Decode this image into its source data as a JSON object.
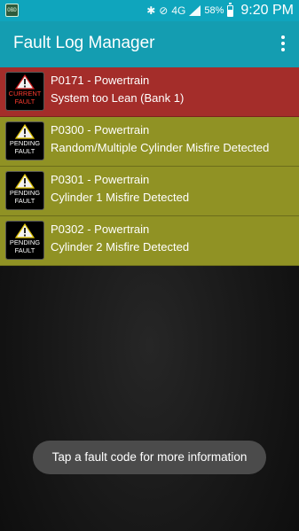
{
  "status_bar": {
    "network": "4G",
    "battery_percent": "58%",
    "battery_level": 0.58,
    "time": "9:20 PM",
    "icons": [
      "app-notification-icon",
      "bluetooth-icon",
      "vibrate-icon",
      "lte-icon",
      "signal-icon",
      "battery-icon"
    ]
  },
  "app_bar": {
    "title": "Fault Log Manager",
    "menu_icon": "overflow-menu-icon"
  },
  "faults": [
    {
      "code": "P0171 - Powertrain",
      "description": "System too Lean (Bank 1)",
      "status": [
        "CURRENT",
        "FAULT"
      ],
      "kind": "current",
      "color": "#a42d2a"
    },
    {
      "code": "P0300 - Powertrain",
      "description": "Random/Multiple Cylinder Misfire Detected",
      "status": [
        "PENDING",
        "FAULT"
      ],
      "kind": "pending",
      "color": "#909224"
    },
    {
      "code": "P0301 - Powertrain",
      "description": "Cylinder 1 Misfire Detected",
      "status": [
        "PENDING",
        "FAULT"
      ],
      "kind": "pending",
      "color": "#909224"
    },
    {
      "code": "P0302 - Powertrain",
      "description": "Cylinder 2 Misfire Detected",
      "status": [
        "PENDING",
        "FAULT"
      ],
      "kind": "pending",
      "color": "#909224"
    }
  ],
  "toast": {
    "message": "Tap a fault code for more information"
  },
  "colors": {
    "status_bar": "#0fa5bd",
    "app_bar": "#149db1",
    "current_fault": "#a42d2a",
    "pending_fault": "#909224",
    "current_badge_text": "#ff3b2f"
  }
}
